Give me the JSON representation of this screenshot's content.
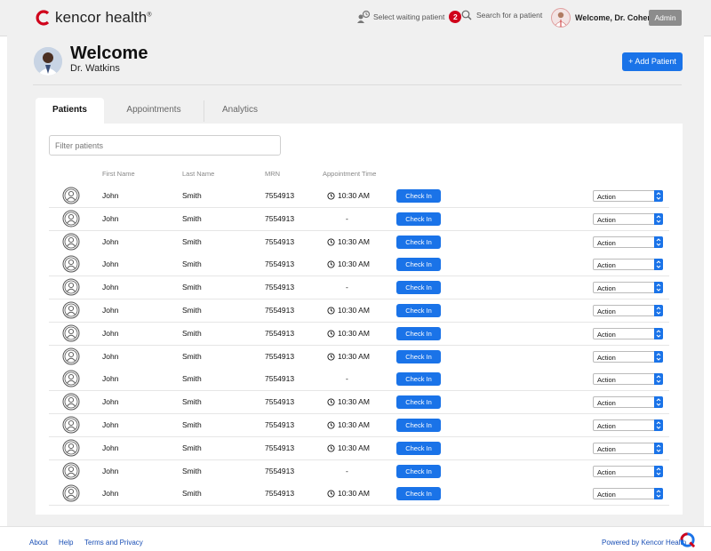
{
  "app": {
    "logo_text": "kencor health",
    "logo_mark": "®"
  },
  "header": {
    "waiting_label": "Select waiting patient",
    "waiting_count": "2",
    "search_placeholder": "Search for a patient",
    "welcome_user": "Welcome, Dr. Cohen",
    "admin_label": "Admin"
  },
  "page": {
    "title": "Welcome",
    "subtitle": "Dr. Watkins",
    "add_patient_label": "+ Add Patient"
  },
  "tabs": [
    {
      "label": "Patients",
      "active": true
    },
    {
      "label": "Appointments",
      "active": false
    },
    {
      "label": "Analytics",
      "active": false
    }
  ],
  "filter": {
    "placeholder": "Filter patients"
  },
  "table": {
    "columns": [
      "First Name",
      "Last Name",
      "MRN",
      "Appointment Time"
    ],
    "checkin_label": "Check In",
    "action_label": "Action",
    "rows": [
      {
        "first": "John",
        "last": "Smith",
        "mrn": "7554913",
        "time": "10:30 AM"
      },
      {
        "first": "John",
        "last": "Smith",
        "mrn": "7554913",
        "time": "-"
      },
      {
        "first": "John",
        "last": "Smith",
        "mrn": "7554913",
        "time": "10:30 AM"
      },
      {
        "first": "John",
        "last": "Smith",
        "mrn": "7554913",
        "time": "10:30 AM"
      },
      {
        "first": "John",
        "last": "Smith",
        "mrn": "7554913",
        "time": "-"
      },
      {
        "first": "John",
        "last": "Smith",
        "mrn": "7554913",
        "time": "10:30 AM"
      },
      {
        "first": "John",
        "last": "Smith",
        "mrn": "7554913",
        "time": "10:30 AM"
      },
      {
        "first": "John",
        "last": "Smith",
        "mrn": "7554913",
        "time": "10:30 AM"
      },
      {
        "first": "John",
        "last": "Smith",
        "mrn": "7554913",
        "time": "-"
      },
      {
        "first": "John",
        "last": "Smith",
        "mrn": "7554913",
        "time": "10:30 AM"
      },
      {
        "first": "John",
        "last": "Smith",
        "mrn": "7554913",
        "time": "10:30 AM"
      },
      {
        "first": "John",
        "last": "Smith",
        "mrn": "7554913",
        "time": "10:30 AM"
      },
      {
        "first": "John",
        "last": "Smith",
        "mrn": "7554913",
        "time": "-"
      },
      {
        "first": "John",
        "last": "Smith",
        "mrn": "7554913",
        "time": "10:30 AM"
      }
    ]
  },
  "footer": {
    "about": "About",
    "help": "Help",
    "terms": "Terms and Privacy",
    "powered": "Powered by Kencor Health"
  },
  "colors": {
    "accent": "#1a73e8",
    "logo_red": "#d0021b",
    "badge_red": "#d0021b"
  }
}
